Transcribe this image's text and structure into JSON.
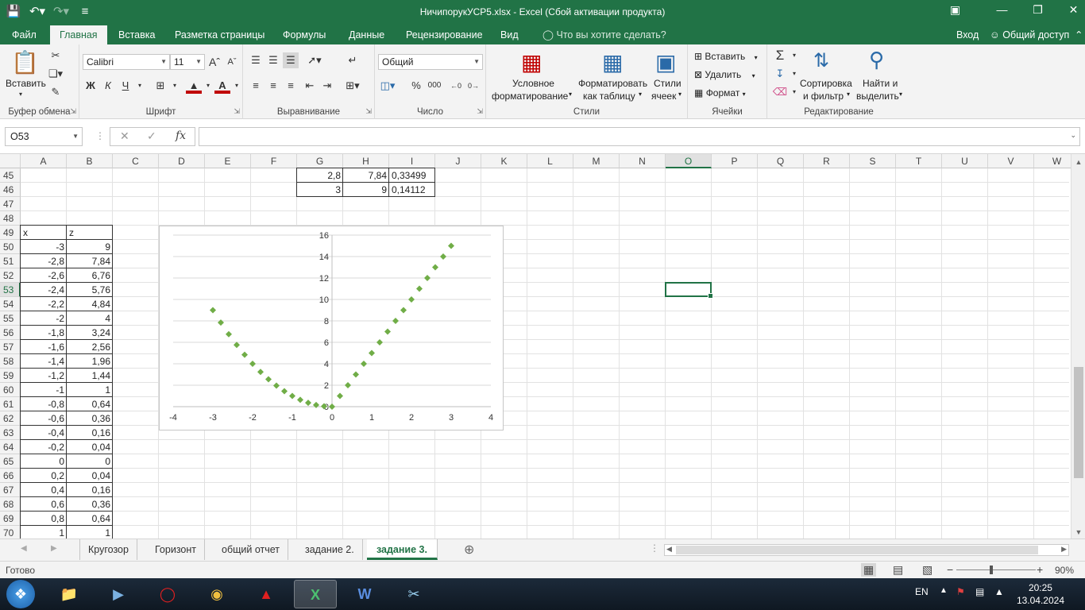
{
  "window": {
    "title": "НичипорукУСР5.xlsx - Excel (Сбой активации продукта)"
  },
  "tabs": [
    {
      "label": "Файл"
    },
    {
      "label": "Главная"
    },
    {
      "label": "Вставка"
    },
    {
      "label": "Разметка страницы"
    },
    {
      "label": "Формулы"
    },
    {
      "label": "Данные"
    },
    {
      "label": "Рецензирование"
    },
    {
      "label": "Вид"
    }
  ],
  "tell_me": "Что вы хотите сделать?",
  "signin": "Вход",
  "share": "Общий доступ",
  "ribbon": {
    "clipboard": {
      "label": "Буфер обмена",
      "paste": "Вставить"
    },
    "font": {
      "label": "Шрифт",
      "name": "Calibri",
      "size": "11",
      "bold": "Ж",
      "italic": "К",
      "underline": "Ч"
    },
    "alignment": {
      "label": "Выравнивание"
    },
    "number": {
      "label": "Число",
      "format": "Общий",
      "percent": "%",
      "thousands": "000"
    },
    "styles": {
      "label": "Стили",
      "conditional_line1": "Условное",
      "conditional_line2": "форматирование",
      "table_line1": "Форматировать",
      "table_line2": "как таблицу",
      "cell_line1": "Стили",
      "cell_line2": "ячеек"
    },
    "cells": {
      "label": "Ячейки",
      "insert": "Вставить",
      "delete": "Удалить",
      "format": "Формат"
    },
    "editing": {
      "label": "Редактирование",
      "sort_line1": "Сортировка",
      "sort_line2": "и фильтр",
      "find_line1": "Найти и",
      "find_line2": "выделить"
    }
  },
  "formula_bar": {
    "name_box": "O53",
    "formula": ""
  },
  "columns": [
    "A",
    "B",
    "C",
    "D",
    "E",
    "F",
    "G",
    "H",
    "I",
    "J",
    "K",
    "L",
    "M",
    "N",
    "O",
    "P",
    "Q",
    "R",
    "S",
    "T",
    "U",
    "V",
    "W"
  ],
  "selected_column": "O",
  "rows": [
    "45",
    "46",
    "47",
    "48",
    "49",
    "50",
    "51",
    "52",
    "53",
    "54",
    "55",
    "56",
    "57",
    "58",
    "59",
    "60",
    "61",
    "62",
    "63",
    "64",
    "65",
    "66",
    "67",
    "68",
    "69",
    "70"
  ],
  "selected_row": "53",
  "top_table": [
    {
      "g": "2,8",
      "h": "7,84",
      "i": "0,33499"
    },
    {
      "g": "3",
      "h": "9",
      "i": "0,14112"
    }
  ],
  "xz_table": {
    "headers": [
      "x",
      "z"
    ],
    "rows": [
      [
        "-3",
        "9"
      ],
      [
        "-2,8",
        "7,84"
      ],
      [
        "-2,6",
        "6,76"
      ],
      [
        "-2,4",
        "5,76"
      ],
      [
        "-2,2",
        "4,84"
      ],
      [
        "-2",
        "4"
      ],
      [
        "-1,8",
        "3,24"
      ],
      [
        "-1,6",
        "2,56"
      ],
      [
        "-1,4",
        "1,96"
      ],
      [
        "-1,2",
        "1,44"
      ],
      [
        "-1",
        "1"
      ],
      [
        "-0,8",
        "0,64"
      ],
      [
        "-0,6",
        "0,36"
      ],
      [
        "-0,4",
        "0,16"
      ],
      [
        "-0,2",
        "0,04"
      ],
      [
        "0",
        "0"
      ],
      [
        "0,2",
        "0,04"
      ],
      [
        "0,4",
        "0,16"
      ],
      [
        "0,6",
        "0,36"
      ],
      [
        "0,8",
        "0,64"
      ],
      [
        "1",
        "1"
      ]
    ]
  },
  "chart_data": {
    "type": "scatter",
    "xlim": [
      -4,
      4
    ],
    "ylim": [
      0,
      16
    ],
    "xticks": [
      -4,
      -3,
      -2,
      -1,
      0,
      1,
      2,
      3,
      4
    ],
    "yticks": [
      0,
      2,
      4,
      6,
      8,
      10,
      12,
      14,
      16
    ],
    "grid": "horizontal",
    "marker": "diamond",
    "color": "#70ad47",
    "x": [
      -3,
      -2.8,
      -2.6,
      -2.4,
      -2.2,
      -2,
      -1.8,
      -1.6,
      -1.4,
      -1.2,
      -1,
      -0.8,
      -0.6,
      -0.4,
      -0.2,
      0,
      0.2,
      0.4,
      0.6,
      0.8,
      1,
      1.2,
      1.4,
      1.6,
      1.8,
      2,
      2.2,
      2.4,
      2.6,
      2.8,
      3
    ],
    "y": [
      9,
      7.84,
      6.76,
      5.76,
      4.84,
      4,
      3.24,
      2.56,
      1.96,
      1.44,
      1,
      0.64,
      0.36,
      0.16,
      0.04,
      0,
      1,
      2,
      3,
      4,
      5,
      6,
      7,
      8,
      9,
      10,
      11,
      12,
      13,
      14,
      15
    ]
  },
  "sheets": [
    {
      "label": "Кругозор"
    },
    {
      "label": "Горизонт"
    },
    {
      "label": "общий отчет"
    },
    {
      "label": "задание 2."
    },
    {
      "label": "задание 3."
    }
  ],
  "active_sheet": "задание 3.",
  "status": {
    "ready": "Готово",
    "zoom": "90%"
  },
  "taskbar": {
    "lang": "EN",
    "time": "20:25",
    "date": "13.04.2024"
  },
  "colors": {
    "accent": "#217346",
    "series": "#70ad47"
  }
}
